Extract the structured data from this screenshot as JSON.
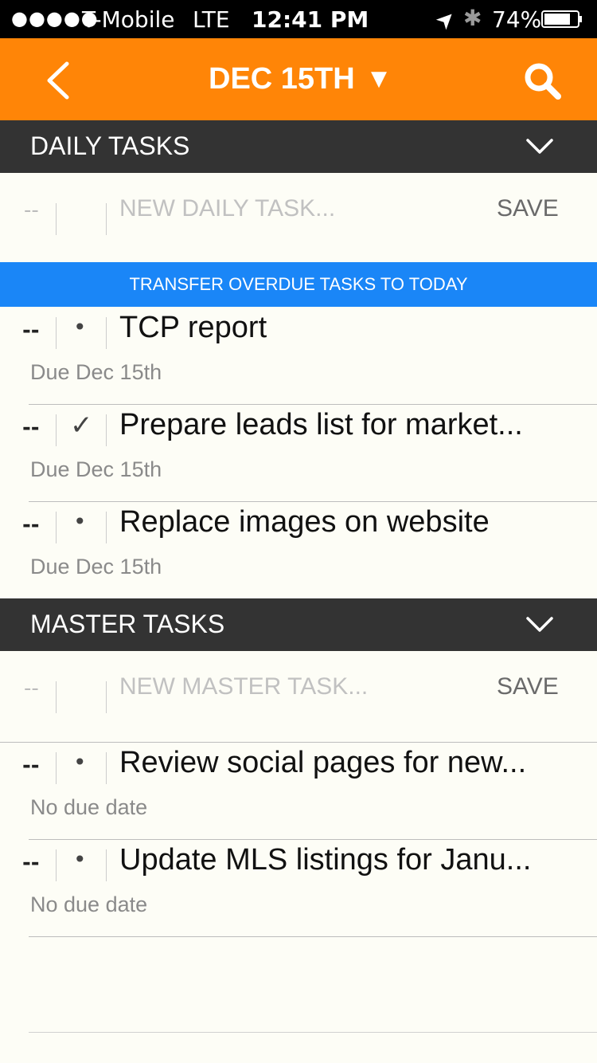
{
  "status": {
    "signal": "●●●●●",
    "carrier": "T-Mobile",
    "network": "LTE",
    "time": "12:41 PM",
    "battery": "74%",
    "location_icon": "➤",
    "bluetooth_icon": "✱"
  },
  "nav": {
    "title": "DEC 15TH",
    "dropdown_glyph": "▼"
  },
  "daily": {
    "header": "DAILY TASKS",
    "new_dash": "--",
    "placeholder": "NEW DAILY TASK...",
    "save": "SAVE",
    "transfer": "TRANSFER OVERDUE TASKS TO TODAY",
    "tasks": [
      {
        "dash": "--",
        "mark": "•",
        "title": "TCP report",
        "due": "Due Dec 15th"
      },
      {
        "dash": "--",
        "mark": "✓",
        "title": "Prepare leads list for market...",
        "due": "Due Dec 15th"
      },
      {
        "dash": "--",
        "mark": "•",
        "title": "Replace images on website",
        "due": "Due Dec 15th"
      }
    ]
  },
  "master": {
    "header": "MASTER TASKS",
    "new_dash": "--",
    "placeholder": "NEW MASTER TASK...",
    "save": "SAVE",
    "tasks": [
      {
        "dash": "--",
        "mark": "•",
        "title": "Review social pages for new...",
        "due": "No due date"
      },
      {
        "dash": "--",
        "mark": "•",
        "title": "Update MLS listings for Janu...",
        "due": "No due date"
      }
    ]
  },
  "colors": {
    "accent": "#ff8507",
    "header_bg": "#333333",
    "transfer_bg": "#1a86f7",
    "page_bg": "#fdfdf6"
  }
}
